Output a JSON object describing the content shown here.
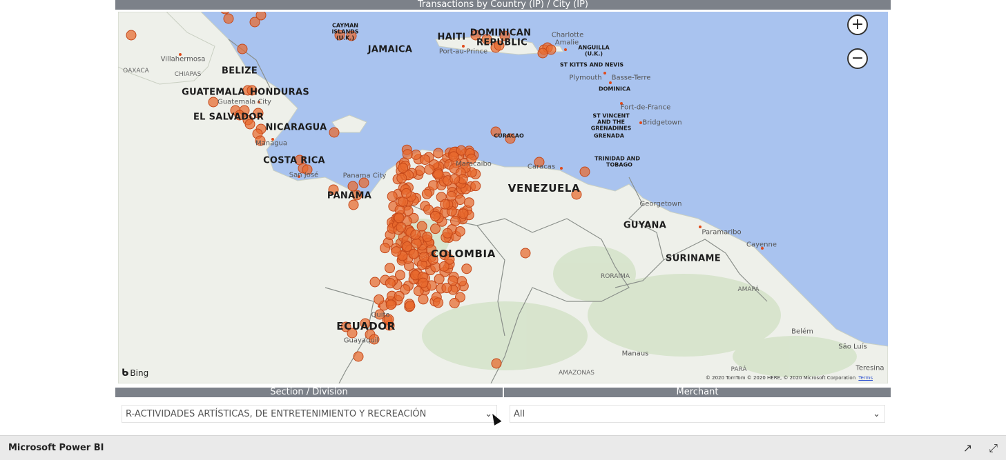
{
  "visual": {
    "title": "Transactions by Country (IP) / City (IP)"
  },
  "map": {
    "zoom_in": "+",
    "zoom_out": "−",
    "bing": "Bing",
    "attribution": "© 2020 TomTom © 2020 HERE, © 2020 Microsoft Corporation",
    "terms": "Terms",
    "colors": {
      "water": "#a9c3ef",
      "land": "#eef0ea",
      "marker": "#e8692e"
    },
    "countries": [
      "BELIZE",
      "GUATEMALA",
      "HONDURAS",
      "EL SALVADOR",
      "NICARAGUA",
      "COSTA RICA",
      "PANAMA",
      "JAMAICA",
      "HAITI",
      "DOMINICAN",
      "REPUBLIC",
      "VENEZUELA",
      "COLOMBIA",
      "ECUADOR",
      "GUYANA",
      "SURINAME"
    ],
    "islands": [
      "CAYMAN",
      "ISLANDS",
      "(U.K.)",
      "ANGUILLA",
      "(U.K.)",
      "ST KITTS AND NEVIS",
      "DOMINICA",
      "ST VINCENT",
      "AND THE",
      "GRENADINES",
      "GRENADA",
      "TRINIDAD AND",
      "TOBAGO",
      "CURACAO"
    ],
    "cities": [
      "Villahermosa",
      "Guatemala City",
      "Managua",
      "San José",
      "Panama City",
      "Port-au-Prince",
      "Charlotte",
      "Amalie",
      "Plymouth",
      "Basse-Terre",
      "Fort-de-France",
      "Bridgetown",
      "Maracaibo",
      "Caracas",
      "Georgetown",
      "Paramaribo",
      "Cayenne",
      "Quito",
      "Guayaquil",
      "Belém",
      "São Luís",
      "Manaus",
      "Teresina"
    ],
    "regions": [
      "OAXACA",
      "CHIAPAS",
      "RORAIMA",
      "AMAPÁ",
      "AMAZONAS",
      "PARÁ"
    ]
  },
  "slicers": {
    "section": {
      "header": "Section / Division",
      "value": "R-ACTIVIDADES ARTÍSTICAS, DE ENTRETENIMIENTO Y RECREACIÓN"
    },
    "merchant": {
      "header": "Merchant",
      "value": "All"
    }
  },
  "footer": {
    "title": "Microsoft Power BI"
  }
}
